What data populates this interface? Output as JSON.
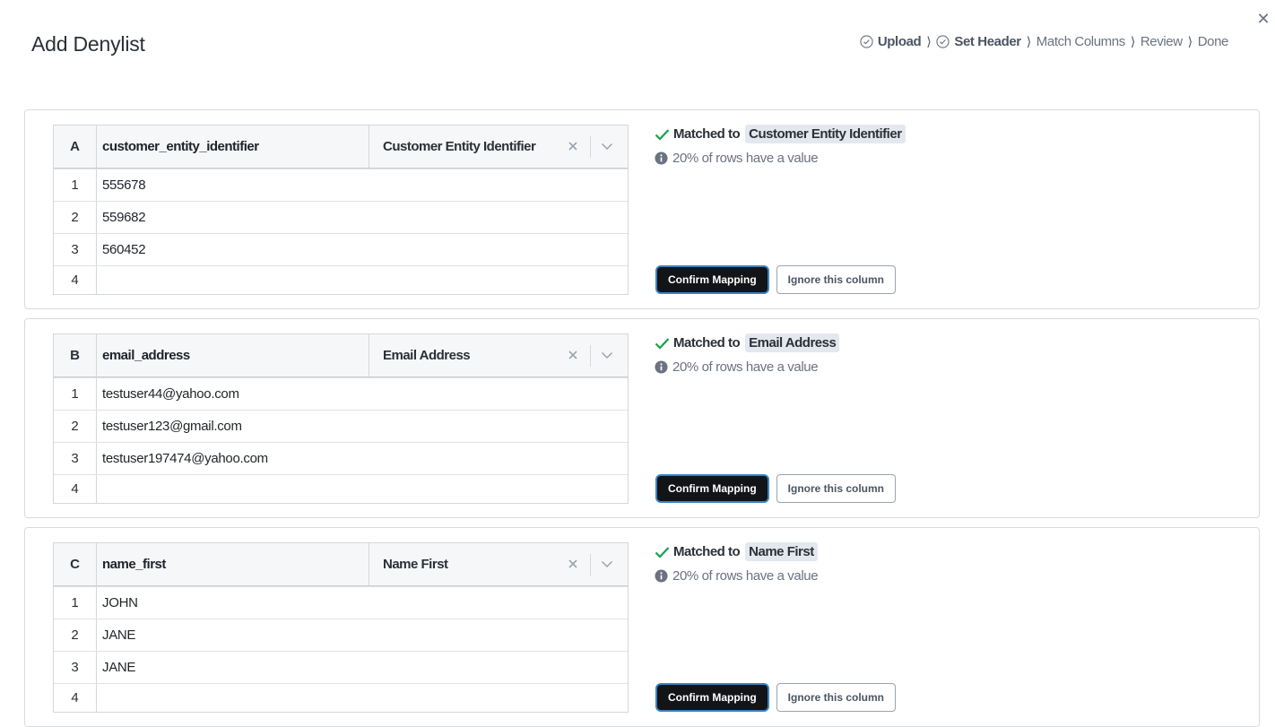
{
  "modal": {
    "title": "Add Denylist"
  },
  "steps": [
    {
      "label": "Upload",
      "done": true
    },
    {
      "label": "Set Header",
      "done": true
    },
    {
      "label": "Match Columns",
      "done": false
    },
    {
      "label": "Review",
      "done": false
    },
    {
      "label": "Done",
      "done": false
    }
  ],
  "colors": {
    "check_green": "#16a34a",
    "primary_button": "#121417",
    "focus_ring": "#3b82c4",
    "pill_bg": "#e3e8f0"
  },
  "columns": [
    {
      "letter": "A",
      "header": "customer_entity_identifier",
      "mapped_to": "Customer Entity Identifier",
      "rows": [
        {
          "n": "1",
          "value": "555678"
        },
        {
          "n": "2",
          "value": "559682"
        },
        {
          "n": "3",
          "value": "560452"
        },
        {
          "n": "4",
          "value": ""
        }
      ],
      "matched_prefix": "Matched to",
      "matched_field": "Customer Entity Identifier",
      "coverage": "20% of rows have a value",
      "confirm_label": "Confirm Mapping",
      "ignore_label": "Ignore this column"
    },
    {
      "letter": "B",
      "header": "email_address",
      "mapped_to": "Email Address",
      "rows": [
        {
          "n": "1",
          "value": "testuser44@yahoo.com"
        },
        {
          "n": "2",
          "value": "testuser123@gmail.com"
        },
        {
          "n": "3",
          "value": "testuser197474@yahoo.com"
        },
        {
          "n": "4",
          "value": ""
        }
      ],
      "matched_prefix": "Matched to",
      "matched_field": "Email Address",
      "coverage": "20% of rows have a value",
      "confirm_label": "Confirm Mapping",
      "ignore_label": "Ignore this column"
    },
    {
      "letter": "C",
      "header": "name_first",
      "mapped_to": "Name First",
      "rows": [
        {
          "n": "1",
          "value": "JOHN"
        },
        {
          "n": "2",
          "value": "JANE"
        },
        {
          "n": "3",
          "value": "JANE"
        },
        {
          "n": "4",
          "value": ""
        }
      ],
      "matched_prefix": "Matched to",
      "matched_field": "Name First",
      "coverage": "20% of rows have a value",
      "confirm_label": "Confirm Mapping",
      "ignore_label": "Ignore this column"
    }
  ]
}
